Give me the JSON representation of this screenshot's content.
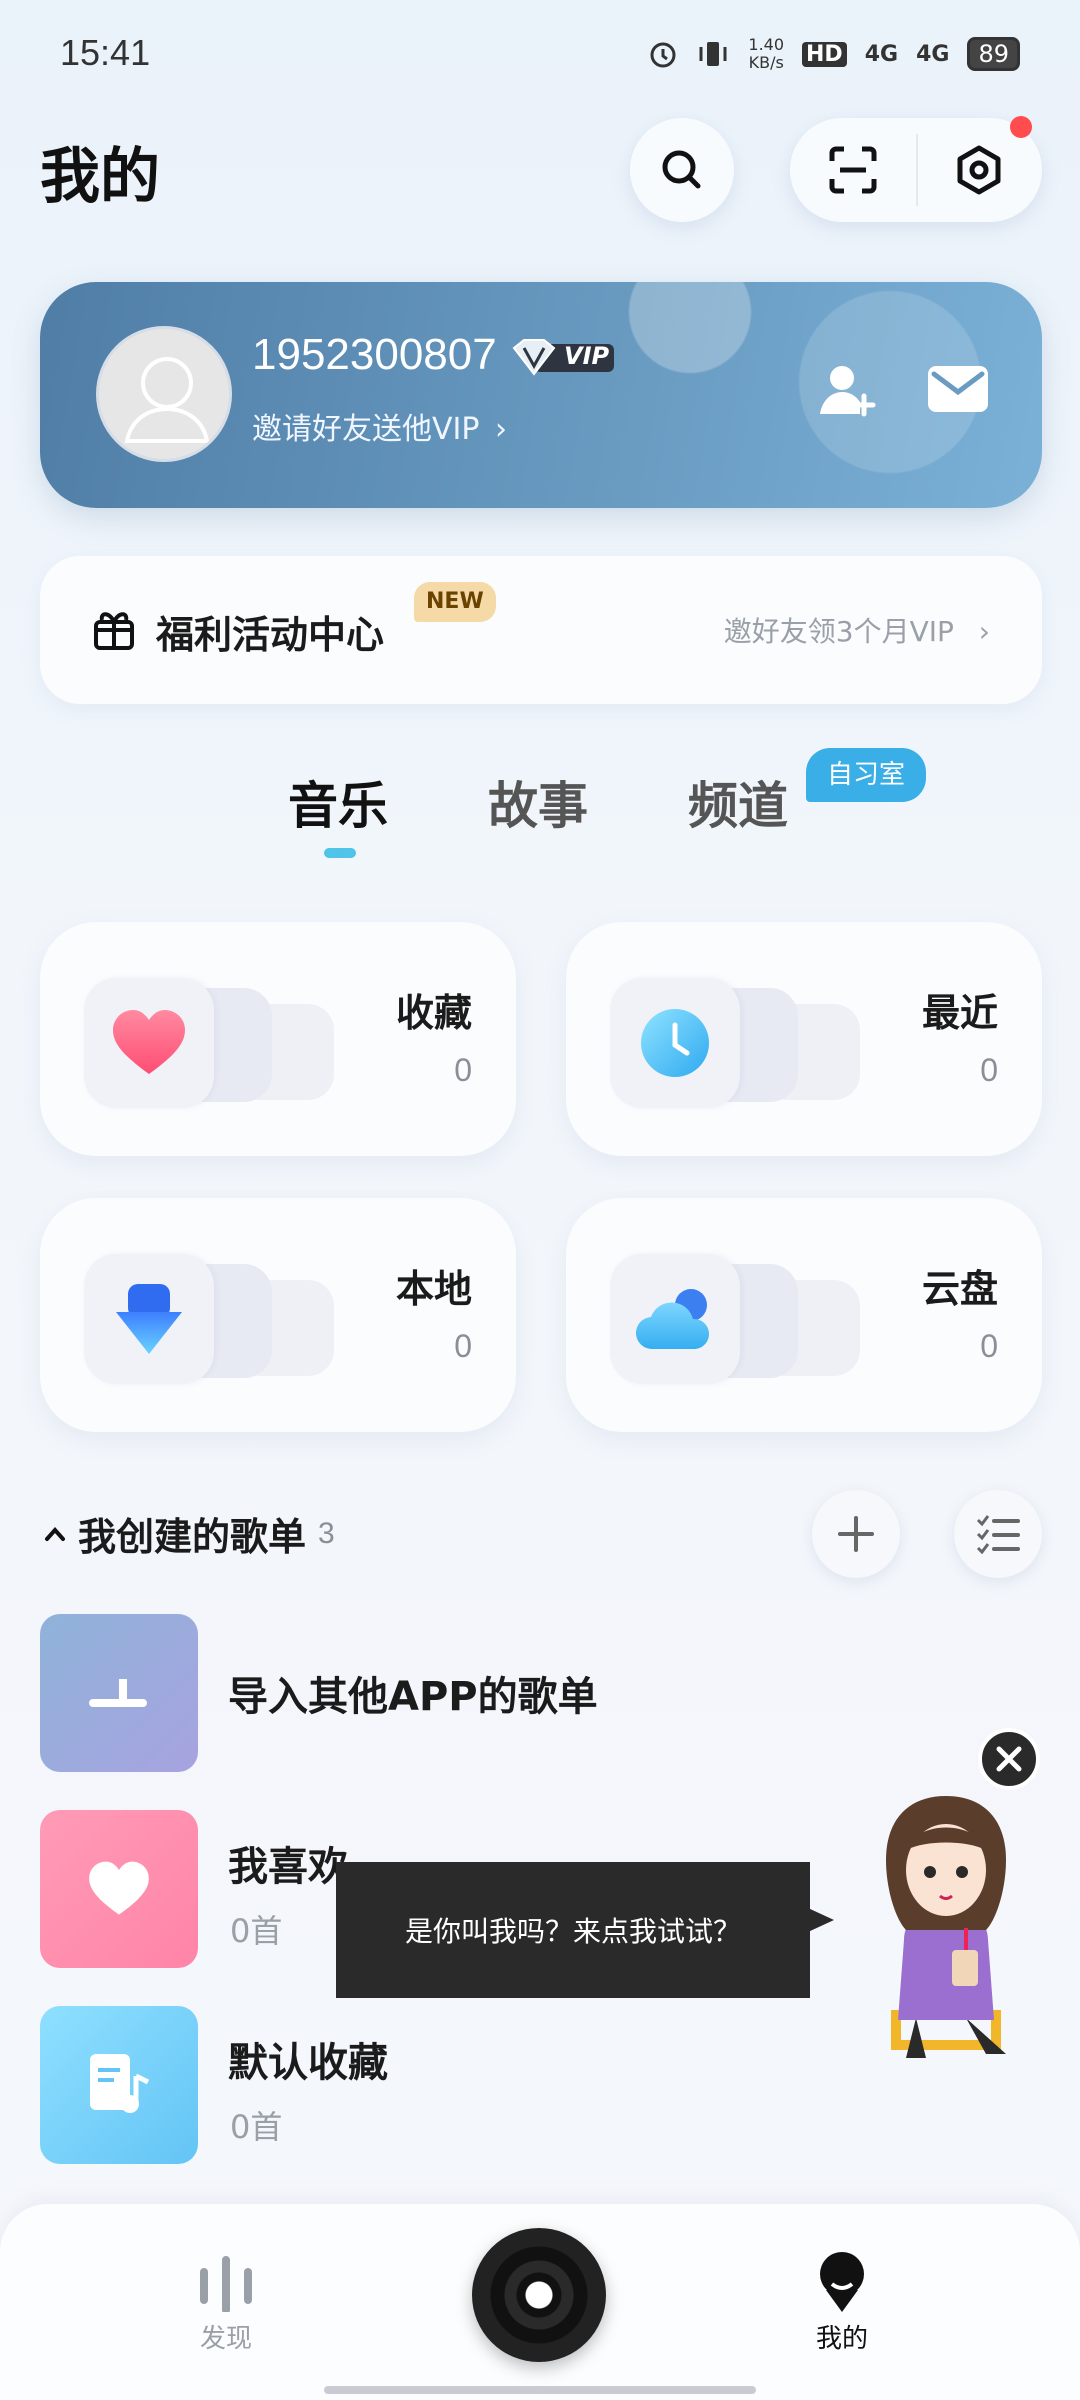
{
  "status_bar": {
    "time": "15:41",
    "net_speed_value": "1.40",
    "net_speed_unit": "KB/s",
    "hd_label": "HD",
    "signal1": "4G",
    "signal2": "4G",
    "battery": "89"
  },
  "header": {
    "title": "我的"
  },
  "profile": {
    "username": "1952300807",
    "vip_label": "VIP",
    "invite_text": "邀请好友送他VIP"
  },
  "welfare": {
    "title": "福利活动中心",
    "new_tag": "NEW",
    "subtitle": "邀好友领3个月VIP"
  },
  "tabs": [
    {
      "label": "音乐",
      "active": true
    },
    {
      "label": "故事",
      "active": false
    },
    {
      "label": "频道",
      "active": false,
      "tag": "自习室"
    }
  ],
  "grid": [
    {
      "title": "收藏",
      "count": "0",
      "icon": "heart-icon"
    },
    {
      "title": "最近",
      "count": "0",
      "icon": "clock-icon"
    },
    {
      "title": "本地",
      "count": "0",
      "icon": "download-icon"
    },
    {
      "title": "云盘",
      "count": "0",
      "icon": "cloud-icon"
    }
  ],
  "playlists_section": {
    "title": "我创建的歌单",
    "count": "3"
  },
  "playlists": [
    {
      "title": "导入其他APP的歌单",
      "subtitle": "",
      "icon": "import-icon"
    },
    {
      "title": "我喜欢",
      "subtitle": "0首",
      "icon": "heart-icon"
    },
    {
      "title": "默认收藏",
      "subtitle": "0首",
      "icon": "music-note-icon"
    }
  ],
  "tooltip": {
    "text": "是你叫我吗？来点我试试？"
  },
  "bottom_nav": {
    "discover_label": "发现",
    "mine_label": "我的"
  },
  "colors": {
    "accent": "#4fc3e8",
    "card_blue": "#5a8ab3",
    "study_tag": "#3aaee6",
    "new_tag_bg": "#f5d9a6"
  }
}
